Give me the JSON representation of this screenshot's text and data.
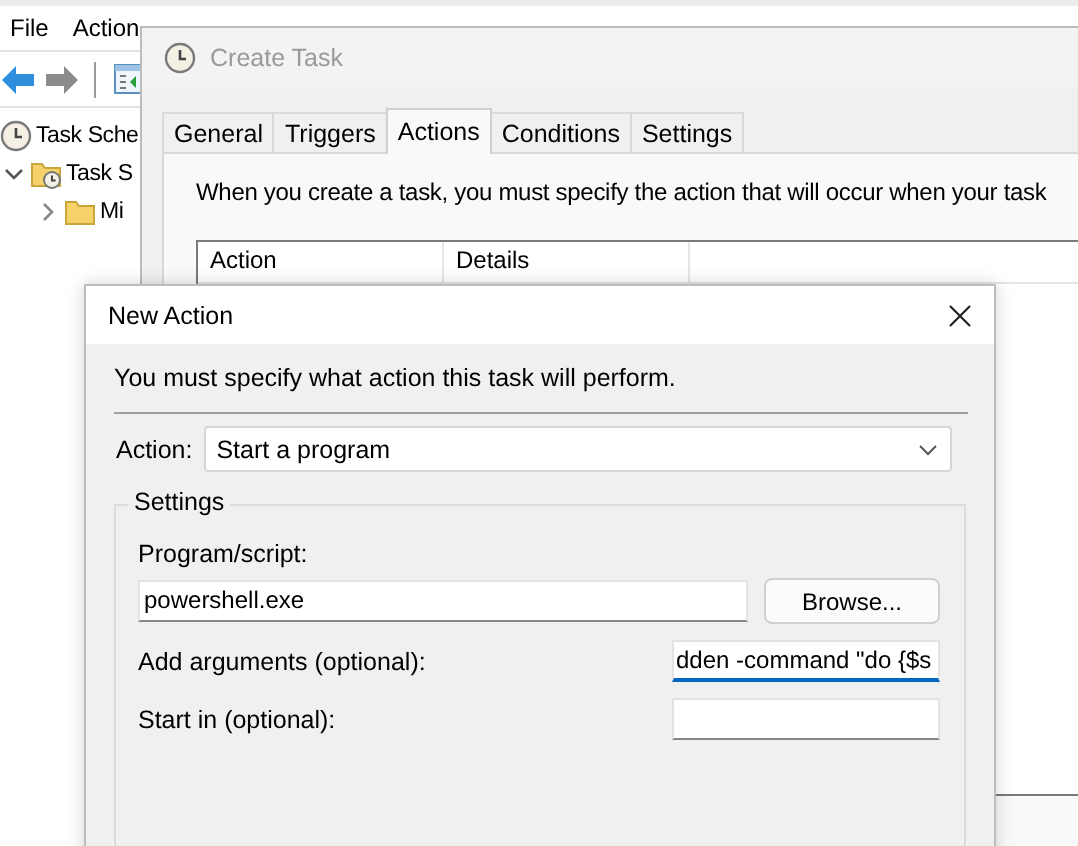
{
  "main_window": {
    "menu": [
      "File",
      "Action"
    ],
    "tree": [
      {
        "label": "Task Sche",
        "children": [
          {
            "label": "Task S",
            "expanded": true,
            "children": [
              {
                "label": "Mi",
                "expanded": false
              }
            ]
          }
        ]
      }
    ]
  },
  "create_task": {
    "title": "Create Task",
    "active": false,
    "tabs": [
      {
        "label": "General",
        "selected": false
      },
      {
        "label": "Triggers",
        "selected": false
      },
      {
        "label": "Actions",
        "selected": true
      },
      {
        "label": "Conditions",
        "selected": false
      },
      {
        "label": "Settings",
        "selected": false
      }
    ],
    "description": "When you create a task, you must specify the action that will occur when your task",
    "table": {
      "columns": [
        "Action",
        "Details"
      ]
    }
  },
  "new_action": {
    "title": "New Action",
    "instruction": "You must specify what action this task will perform.",
    "action": {
      "label": "Action:",
      "value": "Start a program"
    },
    "group": "Settings",
    "fields": [
      {
        "kind": "wide",
        "label": "Program/script:",
        "value": "powershell.exe",
        "focused": false
      },
      {
        "kind": "inline",
        "label": "Add arguments (optional):",
        "value": "dden -command \"do {$s",
        "focused": true
      },
      {
        "kind": "inline",
        "label": "Start in (optional):",
        "focused": false
      }
    ],
    "browse": "Browse..."
  }
}
